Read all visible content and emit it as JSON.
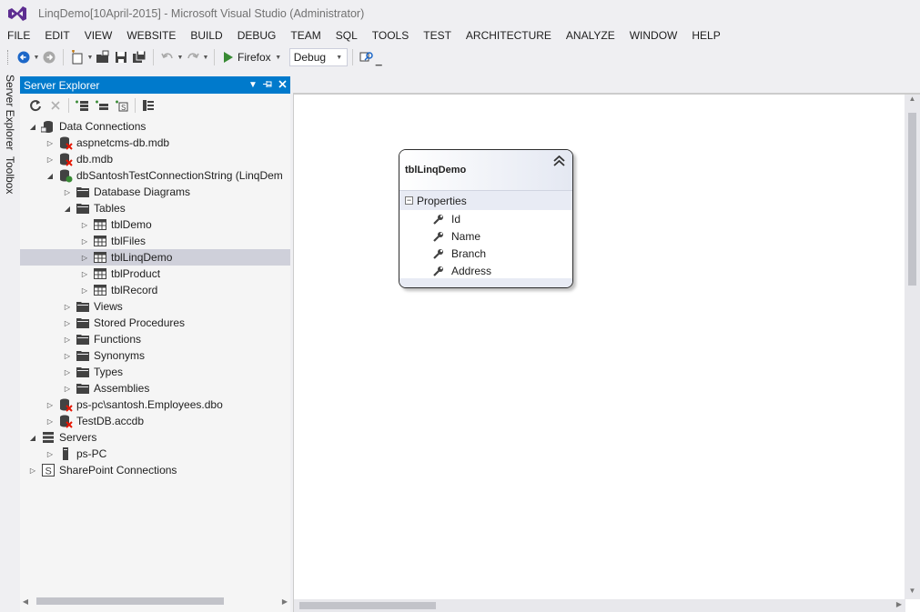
{
  "window": {
    "title": "LinqDemo[10April-2015] - Microsoft Visual Studio (Administrator)"
  },
  "menu": [
    "FILE",
    "EDIT",
    "VIEW",
    "WEBSITE",
    "BUILD",
    "DEBUG",
    "TEAM",
    "SQL",
    "TOOLS",
    "TEST",
    "ARCHITECTURE",
    "ANALYZE",
    "WINDOW",
    "HELP"
  ],
  "toolbar": {
    "run_target": "Firefox",
    "configuration": "Debug",
    "icons": [
      "back-icon",
      "forward-icon",
      "new-project-icon",
      "open-file-icon",
      "save-icon",
      "save-all-icon",
      "undo-icon",
      "redo-icon",
      "start-icon",
      "find-icon"
    ]
  },
  "side_tabs": [
    "Server Explorer",
    "Toolbox"
  ],
  "server_explorer": {
    "title": "Server Explorer",
    "header_buttons": [
      "dropdown-icon",
      "pin-icon",
      "close-icon"
    ],
    "toolbar_icons": [
      "refresh-icon",
      "stop-icon",
      "connect-database-icon",
      "connect-server-icon",
      "sharepoint-connect-icon",
      "properties-icon"
    ],
    "tree": [
      {
        "label": "Data Connections",
        "level": 0,
        "expander": "open",
        "icon": "data-connections-icon"
      },
      {
        "label": "aspnetcms-db.mdb",
        "level": 1,
        "expander": "closed",
        "icon": "database-error-icon"
      },
      {
        "label": "db.mdb",
        "level": 1,
        "expander": "closed",
        "icon": "database-error-icon"
      },
      {
        "label": "dbSantoshTestConnectionString (LinqDem",
        "level": 1,
        "expander": "open",
        "icon": "database-connected-icon"
      },
      {
        "label": "Database Diagrams",
        "level": 2,
        "expander": "closed",
        "icon": "folder-icon"
      },
      {
        "label": "Tables",
        "level": 2,
        "expander": "open",
        "icon": "folder-icon"
      },
      {
        "label": "tblDemo",
        "level": 3,
        "expander": "closed",
        "icon": "table-icon"
      },
      {
        "label": "tblFiles",
        "level": 3,
        "expander": "closed",
        "icon": "table-icon"
      },
      {
        "label": "tblLinqDemo",
        "level": 3,
        "expander": "closed",
        "icon": "table-icon",
        "selected": true
      },
      {
        "label": "tblProduct",
        "level": 3,
        "expander": "closed",
        "icon": "table-icon"
      },
      {
        "label": "tblRecord",
        "level": 3,
        "expander": "closed",
        "icon": "table-icon"
      },
      {
        "label": "Views",
        "level": 2,
        "expander": "closed",
        "icon": "folder-icon"
      },
      {
        "label": "Stored Procedures",
        "level": 2,
        "expander": "closed",
        "icon": "folder-icon"
      },
      {
        "label": "Functions",
        "level": 2,
        "expander": "closed",
        "icon": "folder-icon"
      },
      {
        "label": "Synonyms",
        "level": 2,
        "expander": "closed",
        "icon": "folder-icon"
      },
      {
        "label": "Types",
        "level": 2,
        "expander": "closed",
        "icon": "folder-icon"
      },
      {
        "label": "Assemblies",
        "level": 2,
        "expander": "closed",
        "icon": "folder-icon"
      },
      {
        "label": "ps-pc\\santosh.Employees.dbo",
        "level": 1,
        "expander": "closed",
        "icon": "database-error-icon"
      },
      {
        "label": "TestDB.accdb",
        "level": 1,
        "expander": "closed",
        "icon": "database-error-icon"
      },
      {
        "label": "Servers",
        "level": 0,
        "expander": "open",
        "icon": "servers-icon"
      },
      {
        "label": "ps-PC",
        "level": 1,
        "expander": "closed",
        "icon": "server-icon"
      },
      {
        "label": "SharePoint Connections",
        "level": 0,
        "expander": "closed",
        "icon": "sharepoint-icon"
      }
    ]
  },
  "designer": {
    "entity": {
      "title": "tblLinqDemo",
      "section": "Properties",
      "properties": [
        "Id",
        "Name",
        "Branch",
        "Address"
      ]
    }
  },
  "colors": {
    "accent": "#007acc",
    "selection": "#cfd0da",
    "error": "#e51400",
    "success": "#388a34",
    "play": "#388a34"
  }
}
